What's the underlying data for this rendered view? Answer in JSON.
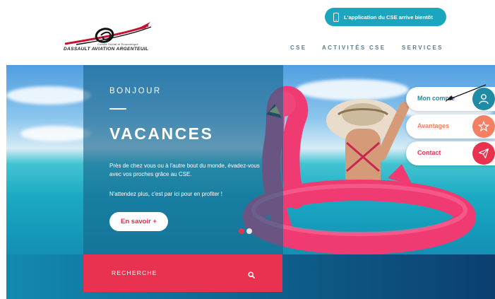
{
  "header": {
    "logo": {
      "line1": "Comité Social et Économique",
      "line2": "DASSAULT AVIATION ARGENTEUIL"
    },
    "app_banner": "L'application du CSE arrive bientôt",
    "nav": [
      {
        "label": "CSE"
      },
      {
        "label": "ACTIVITÉS CSE"
      },
      {
        "label": "SERVICES"
      }
    ]
  },
  "hero": {
    "greeting": "BONJOUR",
    "title": "VACANCES",
    "paragraph1": "Près de chez vous ou à l'autre bout du monde, évadez-vous avec vos proches grâce au CSE.",
    "paragraph2": "N'attendez plus, c'est par ici pour en profiter !",
    "cta_label": "En savoir +"
  },
  "side_menu": [
    {
      "label": "Mon compte",
      "icon": "user-icon",
      "color": "#1f8ba6"
    },
    {
      "label": "Avantages",
      "icon": "star-icon",
      "color": "#f47f62"
    },
    {
      "label": "Contact",
      "icon": "paper-plane-icon",
      "color": "#e8324f"
    }
  ],
  "search": {
    "label": "RECHERCHE",
    "icon": "search-icon"
  },
  "colors": {
    "accent_red": "#e8324f",
    "accent_teal": "#1aa6bf",
    "nav_text": "#5e7b8a"
  }
}
